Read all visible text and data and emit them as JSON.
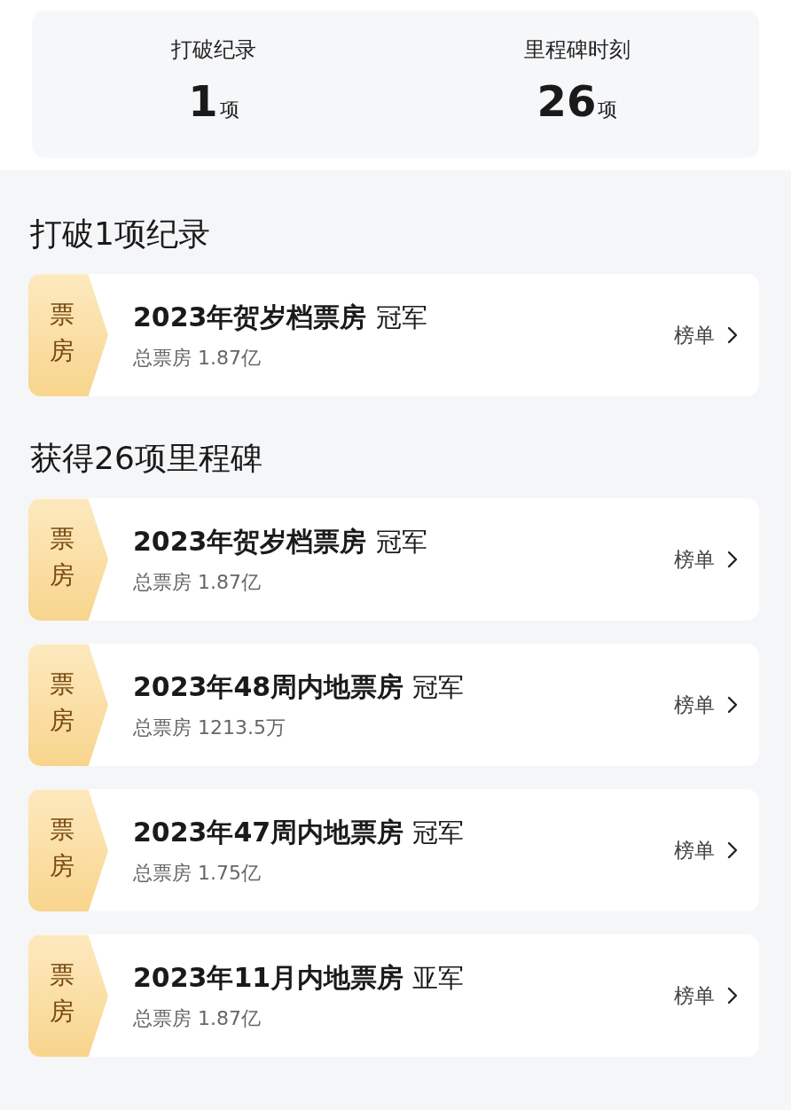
{
  "summary": [
    {
      "label": "打破纪录",
      "value": "1",
      "unit": "项"
    },
    {
      "label": "里程碑时刻",
      "value": "26",
      "unit": "项"
    }
  ],
  "sections": [
    {
      "heading": "打破1项纪录",
      "items": [
        {
          "tag": "票房",
          "title": "2023年贺岁档票房",
          "rank": "冠军",
          "detail": "总票房 1.87亿",
          "link": "榜单"
        }
      ]
    },
    {
      "heading": "获得26项里程碑",
      "items": [
        {
          "tag": "票房",
          "title": "2023年贺岁档票房",
          "rank": "冠军",
          "detail": "总票房 1.87亿",
          "link": "榜单"
        },
        {
          "tag": "票房",
          "title": "2023年48周内地票房",
          "rank": "冠军",
          "detail": "总票房 1213.5万",
          "link": "榜单"
        },
        {
          "tag": "票房",
          "title": "2023年47周内地票房",
          "rank": "冠军",
          "detail": "总票房 1.75亿",
          "link": "榜单"
        },
        {
          "tag": "票房",
          "title": "2023年11月内地票房",
          "rank": "亚军",
          "detail": "总票房 1.87亿",
          "link": "榜单"
        }
      ]
    }
  ]
}
